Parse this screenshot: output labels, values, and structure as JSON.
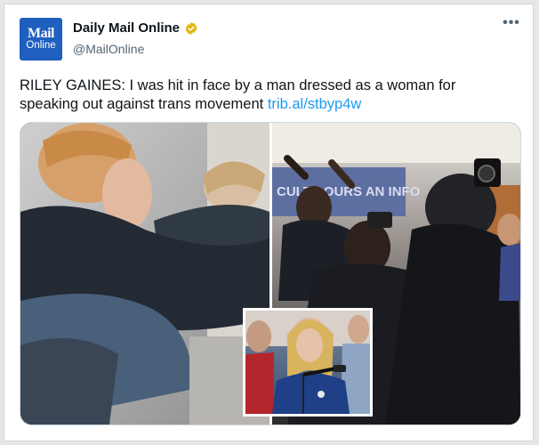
{
  "account": {
    "avatar_line1": "Mail",
    "avatar_line2": "Online",
    "display_name": "Daily Mail Online",
    "handle": "@MailOnline",
    "verified_icon": "verified-badge-icon",
    "verified_color": "#e2b719"
  },
  "menu": {
    "more_label": "•••",
    "icon": "more-options-icon"
  },
  "tweet": {
    "text": "RILEY GAINES: I was hit in face by a man dressed as a woman for speaking out against trans movement",
    "link_text": "trib.al/stbyp4w",
    "link_color": "#1d9bf0"
  },
  "media": {
    "icon": "photo-collage",
    "background_sign_text": "CULTY OURS AN INFO"
  },
  "colors": {
    "background": "#e7e7e7",
    "card": "#ffffff",
    "text": "#0f1419",
    "secondary": "#536471",
    "brand": "#1f5fbf"
  }
}
